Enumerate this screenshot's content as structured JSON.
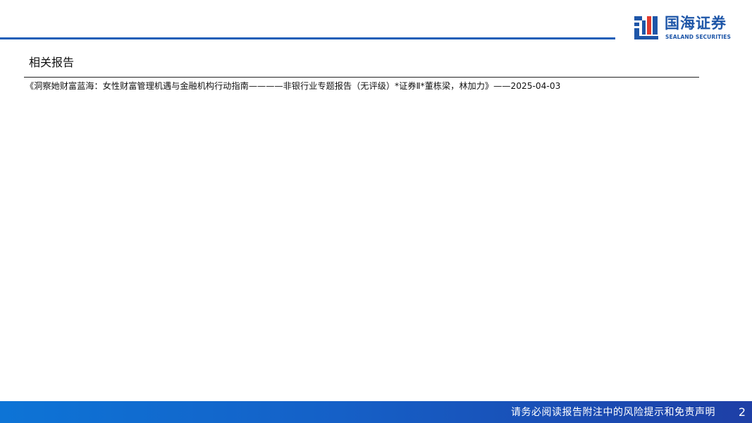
{
  "brand": {
    "name_cn": "国海证券",
    "name_en": "SEALAND SECURITIES",
    "logo_icon": "sealand-logo-mark",
    "accent_color": "#1f5fb8"
  },
  "section": {
    "title": "相关报告"
  },
  "reports": [
    {
      "text": "《洞察她财富蓝海：女性财富管理机遇与金融机构行动指南————非银行业专题报告（无评级）*证券Ⅱ*董栋梁，林加力》——2025-04-03"
    }
  ],
  "footer": {
    "disclaimer": "请务必阅读报告附注中的风险提示和免责声明",
    "page_number": "2"
  }
}
